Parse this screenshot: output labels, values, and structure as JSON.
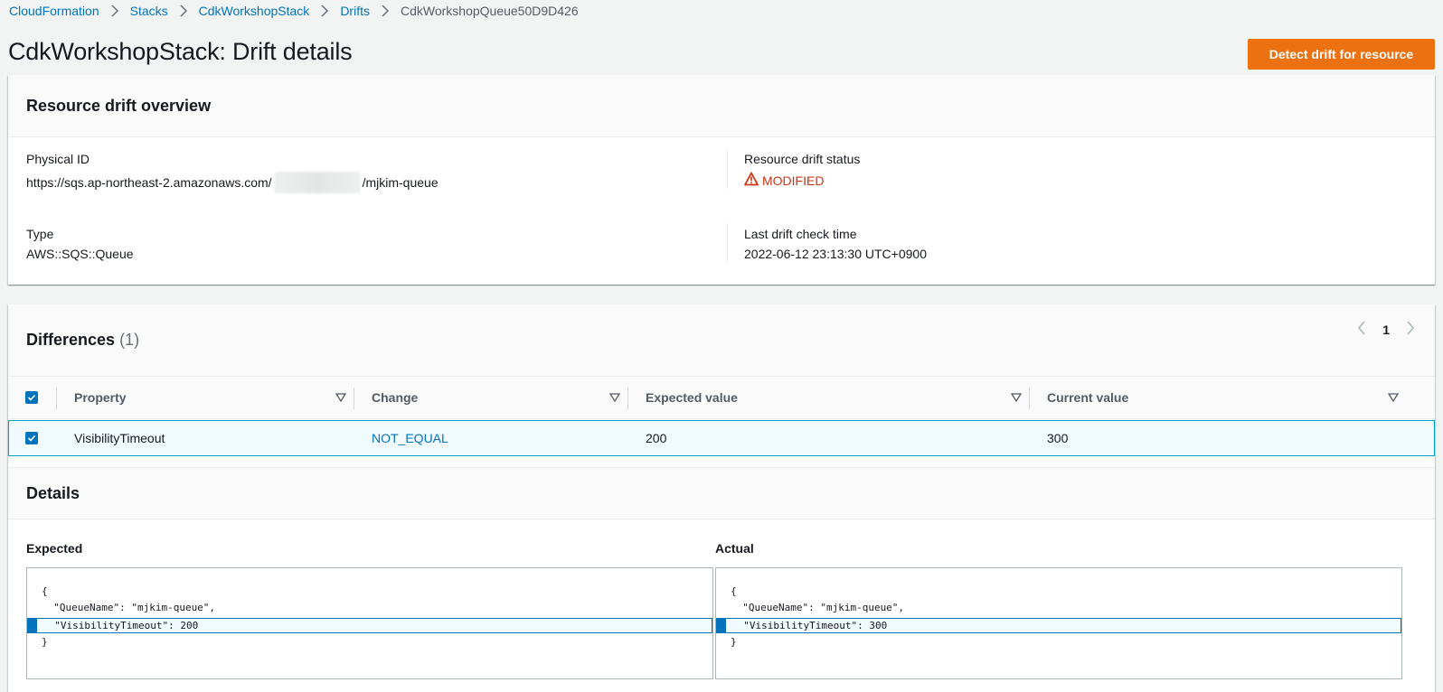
{
  "breadcrumb": {
    "items": [
      "CloudFormation",
      "Stacks",
      "CdkWorkshopStack",
      "Drifts"
    ],
    "current": "CdkWorkshopQueue50D9D426"
  },
  "page": {
    "title": "CdkWorkshopStack: Drift details",
    "detect_button": "Detect drift for resource"
  },
  "overview": {
    "title": "Resource drift overview",
    "physical_id_label": "Physical ID",
    "physical_id_prefix": "https://sqs.ap-northeast-2.amazonaws.com/",
    "physical_id_suffix": "/mjkim-queue",
    "type_label": "Type",
    "type_value": "AWS::SQS::Queue",
    "status_label": "Resource drift status",
    "status_value": "MODIFIED",
    "last_check_label": "Last drift check time",
    "last_check_value": "2022-06-12 23:13:30 UTC+0900"
  },
  "differences": {
    "title": "Differences",
    "count": "(1)",
    "page": "1",
    "columns": [
      "Property",
      "Change",
      "Expected value",
      "Current value"
    ],
    "rows": [
      {
        "property": "VisibilityTimeout",
        "change": "NOT_EQUAL",
        "expected": "200",
        "current": "300"
      }
    ]
  },
  "details": {
    "title": "Details",
    "expected_label": "Expected",
    "actual_label": "Actual",
    "expected_lines": [
      "{",
      "  \"QueueName\": \"mjkim-queue\",",
      "  \"VisibilityTimeout\": 200",
      "}"
    ],
    "actual_lines": [
      "{",
      "  \"QueueName\": \"mjkim-queue\",",
      "  \"VisibilityTimeout\": 300",
      "}"
    ]
  },
  "colors": {
    "accent": "#0073bb",
    "primary_button": "#ec7211",
    "error": "#d13212"
  }
}
